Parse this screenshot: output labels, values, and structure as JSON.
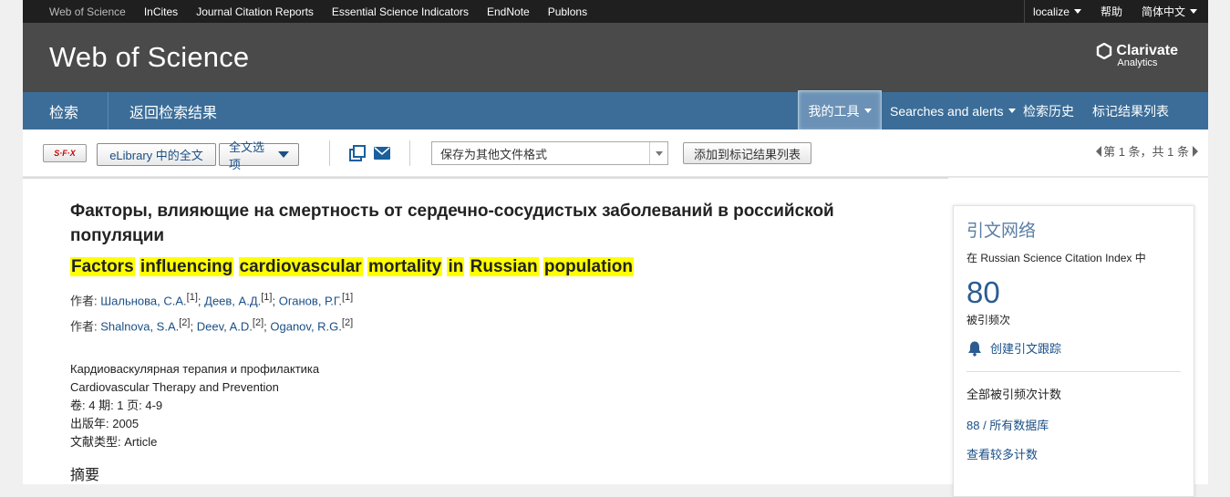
{
  "topbar": {
    "links": [
      "Web of Science",
      "InCites",
      "Journal Citation Reports",
      "Essential Science Indicators",
      "EndNote",
      "Publons"
    ],
    "localize": "localize",
    "help": "帮助",
    "language": "简体中文"
  },
  "header": {
    "brand": "Web of Science",
    "clarivate": "Clarivate",
    "clarivate_sub": "Analytics"
  },
  "nav": {
    "search": "检索",
    "back": "返回检索结果",
    "my_tools": "我的工具",
    "searches_alerts": "Searches and alerts",
    "history": "检索历史",
    "marked_list": "标记结果列表"
  },
  "toolbar": {
    "sfx": "S·F·X",
    "elibrary": "eLibrary 中的全文",
    "fulltext_options": "全文选项",
    "save_format": "保存为其他文件格式",
    "add_marked": "添加到标记结果列表",
    "pager": "第 1 条，共 1 条"
  },
  "record": {
    "title_ru": "Факторы, влияющие на смертность от сердечно-сосудистых заболеваний в российской популяции",
    "title_en_words": [
      "Factors",
      "influencing",
      "cardiovascular",
      "mortality",
      "in",
      "Russian",
      "population"
    ],
    "authors_label": "作者:",
    "authors_ru": [
      {
        "name": "Шальнова, С.А.",
        "ref": "[1]"
      },
      {
        "name": "Деев, А.Д.",
        "ref": "[1]"
      },
      {
        "name": "Оганов, Р.Г.",
        "ref": "[1]"
      }
    ],
    "authors_en": [
      {
        "name": "Shalnova, S.A.",
        "ref": "[2]"
      },
      {
        "name": "Deev, A.D.",
        "ref": "[2]"
      },
      {
        "name": "Oganov, R.G.",
        "ref": "[2]"
      }
    ],
    "journal_ru": "Кардиоваскулярная терапия и профилактика",
    "journal_en": "Cardiovascular Therapy and Prevention",
    "volume_line": "卷: 4 期: 1 页: 4-9",
    "year_line": "出版年: 2005",
    "doctype_line": "文献类型: Article",
    "abstract_heading": "摘要"
  },
  "citation": {
    "heading": "引文网络",
    "index_line": "在 Russian Science Citation Index 中",
    "count": "80",
    "count_label": "被引频次",
    "create_alert": "创建引文跟踪",
    "all_counts": "全部被引频次计数",
    "all_db": "88 / 所有数据库",
    "see_more": "查看较多计数"
  }
}
